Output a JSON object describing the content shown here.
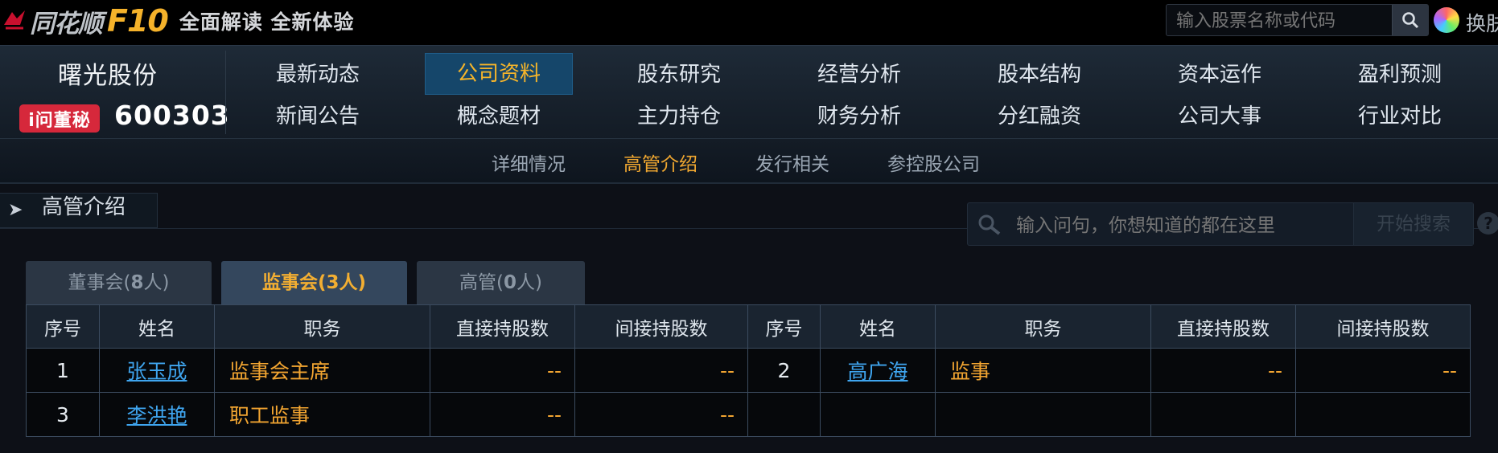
{
  "topbar": {
    "logo_name": "同花顺",
    "logo_f10": "F10",
    "slogan": "全面解读 全新体验",
    "search_placeholder": "输入股票名称或代码",
    "skin_label": "换肤"
  },
  "stock": {
    "name": "曙光股份",
    "dongmi_label": "i问董秘",
    "code": "600303"
  },
  "nav": {
    "row1": [
      "最新动态",
      "公司资料",
      "股东研究",
      "经营分析",
      "股本结构",
      "资本运作",
      "盈利预测"
    ],
    "row2": [
      "新闻公告",
      "概念题材",
      "主力持仓",
      "财务分析",
      "分红融资",
      "公司大事",
      "行业对比"
    ],
    "active": "公司资料"
  },
  "subnav": {
    "items": [
      "详细情况",
      "高管介绍",
      "发行相关",
      "参控股公司"
    ],
    "active": "高管介绍"
  },
  "section": {
    "title": "高管介绍",
    "ask_placeholder": "输入问句，你想知道的都在这里",
    "ask_button": "开始搜索",
    "help": "?"
  },
  "tabs": [
    {
      "label": "董事会",
      "count": "8",
      "unit": "人",
      "active": false
    },
    {
      "label": "监事会",
      "count": "3",
      "unit": "人",
      "active": true
    },
    {
      "label": "高管",
      "count": "0",
      "unit": "人",
      "active": false
    }
  ],
  "table": {
    "headers": [
      "序号",
      "姓名",
      "职务",
      "直接持股数",
      "间接持股数",
      "序号",
      "姓名",
      "职务",
      "直接持股数",
      "间接持股数"
    ],
    "rows": [
      {
        "left": {
          "no": "1",
          "name": "张玉成",
          "role": "监事会主席",
          "direct": "--",
          "indirect": "--"
        },
        "right": {
          "no": "2",
          "name": "高广海",
          "role": "监事",
          "direct": "--",
          "indirect": "--"
        }
      },
      {
        "left": {
          "no": "3",
          "name": "李洪艳",
          "role": "职工监事",
          "direct": "--",
          "indirect": "--"
        },
        "right": {
          "no": "",
          "name": "",
          "role": "",
          "direct": "",
          "indirect": ""
        }
      }
    ]
  },
  "colors": {
    "accent_orange": "#f2a531",
    "link_blue": "#3fa5ef",
    "active_nav_bg": "#15466a",
    "dongmi_red": "#d6283b"
  }
}
